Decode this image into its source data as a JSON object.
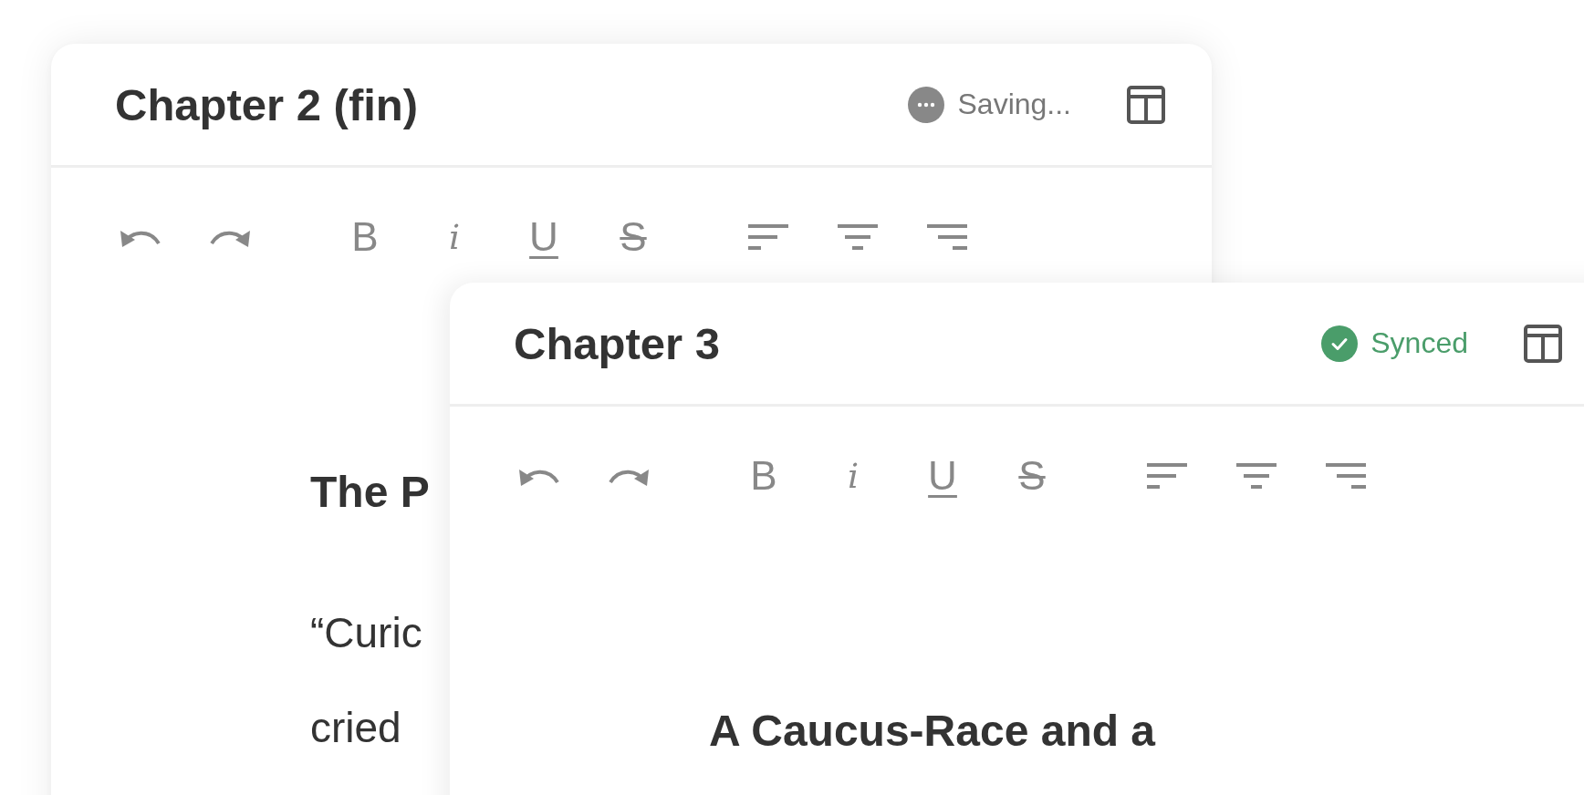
{
  "windows": [
    {
      "title": "Chapter 2 (fin)",
      "status": {
        "kind": "saving",
        "label": "Saving..."
      },
      "toolbar": [
        [
          {
            "kind": "undo"
          },
          {
            "kind": "redo"
          }
        ],
        [
          {
            "kind": "bold",
            "label": "B"
          },
          {
            "kind": "italic",
            "label": "i"
          },
          {
            "kind": "underline",
            "label": "U"
          },
          {
            "kind": "strike",
            "label": "S"
          }
        ],
        [
          {
            "kind": "align-left"
          },
          {
            "kind": "align-center"
          },
          {
            "kind": "align-right"
          }
        ]
      ],
      "body": [
        {
          "kind": "heading",
          "text": "The P"
        },
        {
          "kind": "line",
          "text": "“Curic"
        },
        {
          "kind": "line",
          "text": "cried"
        }
      ]
    },
    {
      "title": "Chapter 3",
      "status": {
        "kind": "synced",
        "label": "Synced"
      },
      "toolbar": [
        [
          {
            "kind": "undo"
          },
          {
            "kind": "redo"
          }
        ],
        [
          {
            "kind": "bold",
            "label": "B"
          },
          {
            "kind": "italic",
            "label": "i"
          },
          {
            "kind": "underline",
            "label": "U"
          },
          {
            "kind": "strike",
            "label": "S"
          }
        ],
        [
          {
            "kind": "align-left"
          },
          {
            "kind": "align-center"
          },
          {
            "kind": "align-right"
          }
        ]
      ],
      "body": [
        {
          "kind": "heading",
          "text": "A Caucus-Race and a"
        }
      ]
    }
  ]
}
